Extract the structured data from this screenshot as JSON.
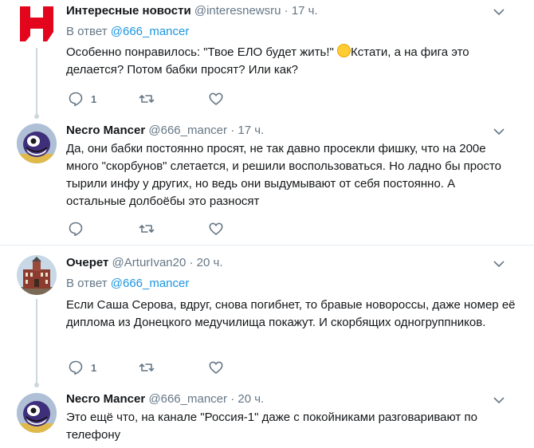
{
  "tweets": [
    {
      "name": "Интересные новости",
      "handle": "@interesnewsru",
      "time": "17 ч.",
      "reply_prefix": "В ответ",
      "reply_to": "@666_mancer",
      "text_before_emoji": "Особенно понравилось: \"Твое ЕЛО будет жить!\" ",
      "emoji": "grinning-face-emoji",
      "text_after_emoji": "Кстати, а на фига это делается? Потом бабки просят? Или как?",
      "replies": "1",
      "retweets": "",
      "likes": ""
    },
    {
      "name": "Necro Mancer",
      "handle": "@666_mancer",
      "time": "17 ч.",
      "text": "Да, они бабки постоянно просят, не так давно просекли фишку, что на 200е много \"скорбунов\" слетается, и решили воспользоваться. Но ладно бы просто тырили инфу у других, но ведь они выдумывают от себя постоянно. А остальные долбоёбы это разносят",
      "replies": "",
      "retweets": "",
      "likes": ""
    },
    {
      "name": "Очерет",
      "handle": "@ArturIvan20",
      "time": "20 ч.",
      "reply_prefix": "В ответ",
      "reply_to": "@666_mancer",
      "text": "Если Саша Серова, вдруг, снова погибнет, то бравые новороссы, даже номер её диплома из Донецкого медучилища покажут. И скорбящих одногруппников.",
      "replies": "1",
      "retweets": "",
      "likes": ""
    },
    {
      "name": "Necro Mancer",
      "handle": "@666_mancer",
      "time": "20 ч.",
      "text": "Это ещё что, на канале \"Россия-1\" даже с покойниками разговаривают по телефону"
    }
  ],
  "colors": {
    "accent": "#1b95e0",
    "muted": "#657786",
    "logo_red": "#e3051b"
  },
  "icons": [
    "interesting-news-logo-avatar",
    "monster-avatar",
    "building-avatar",
    "chevron-down-icon",
    "reply-icon",
    "retweet-icon",
    "like-icon"
  ]
}
